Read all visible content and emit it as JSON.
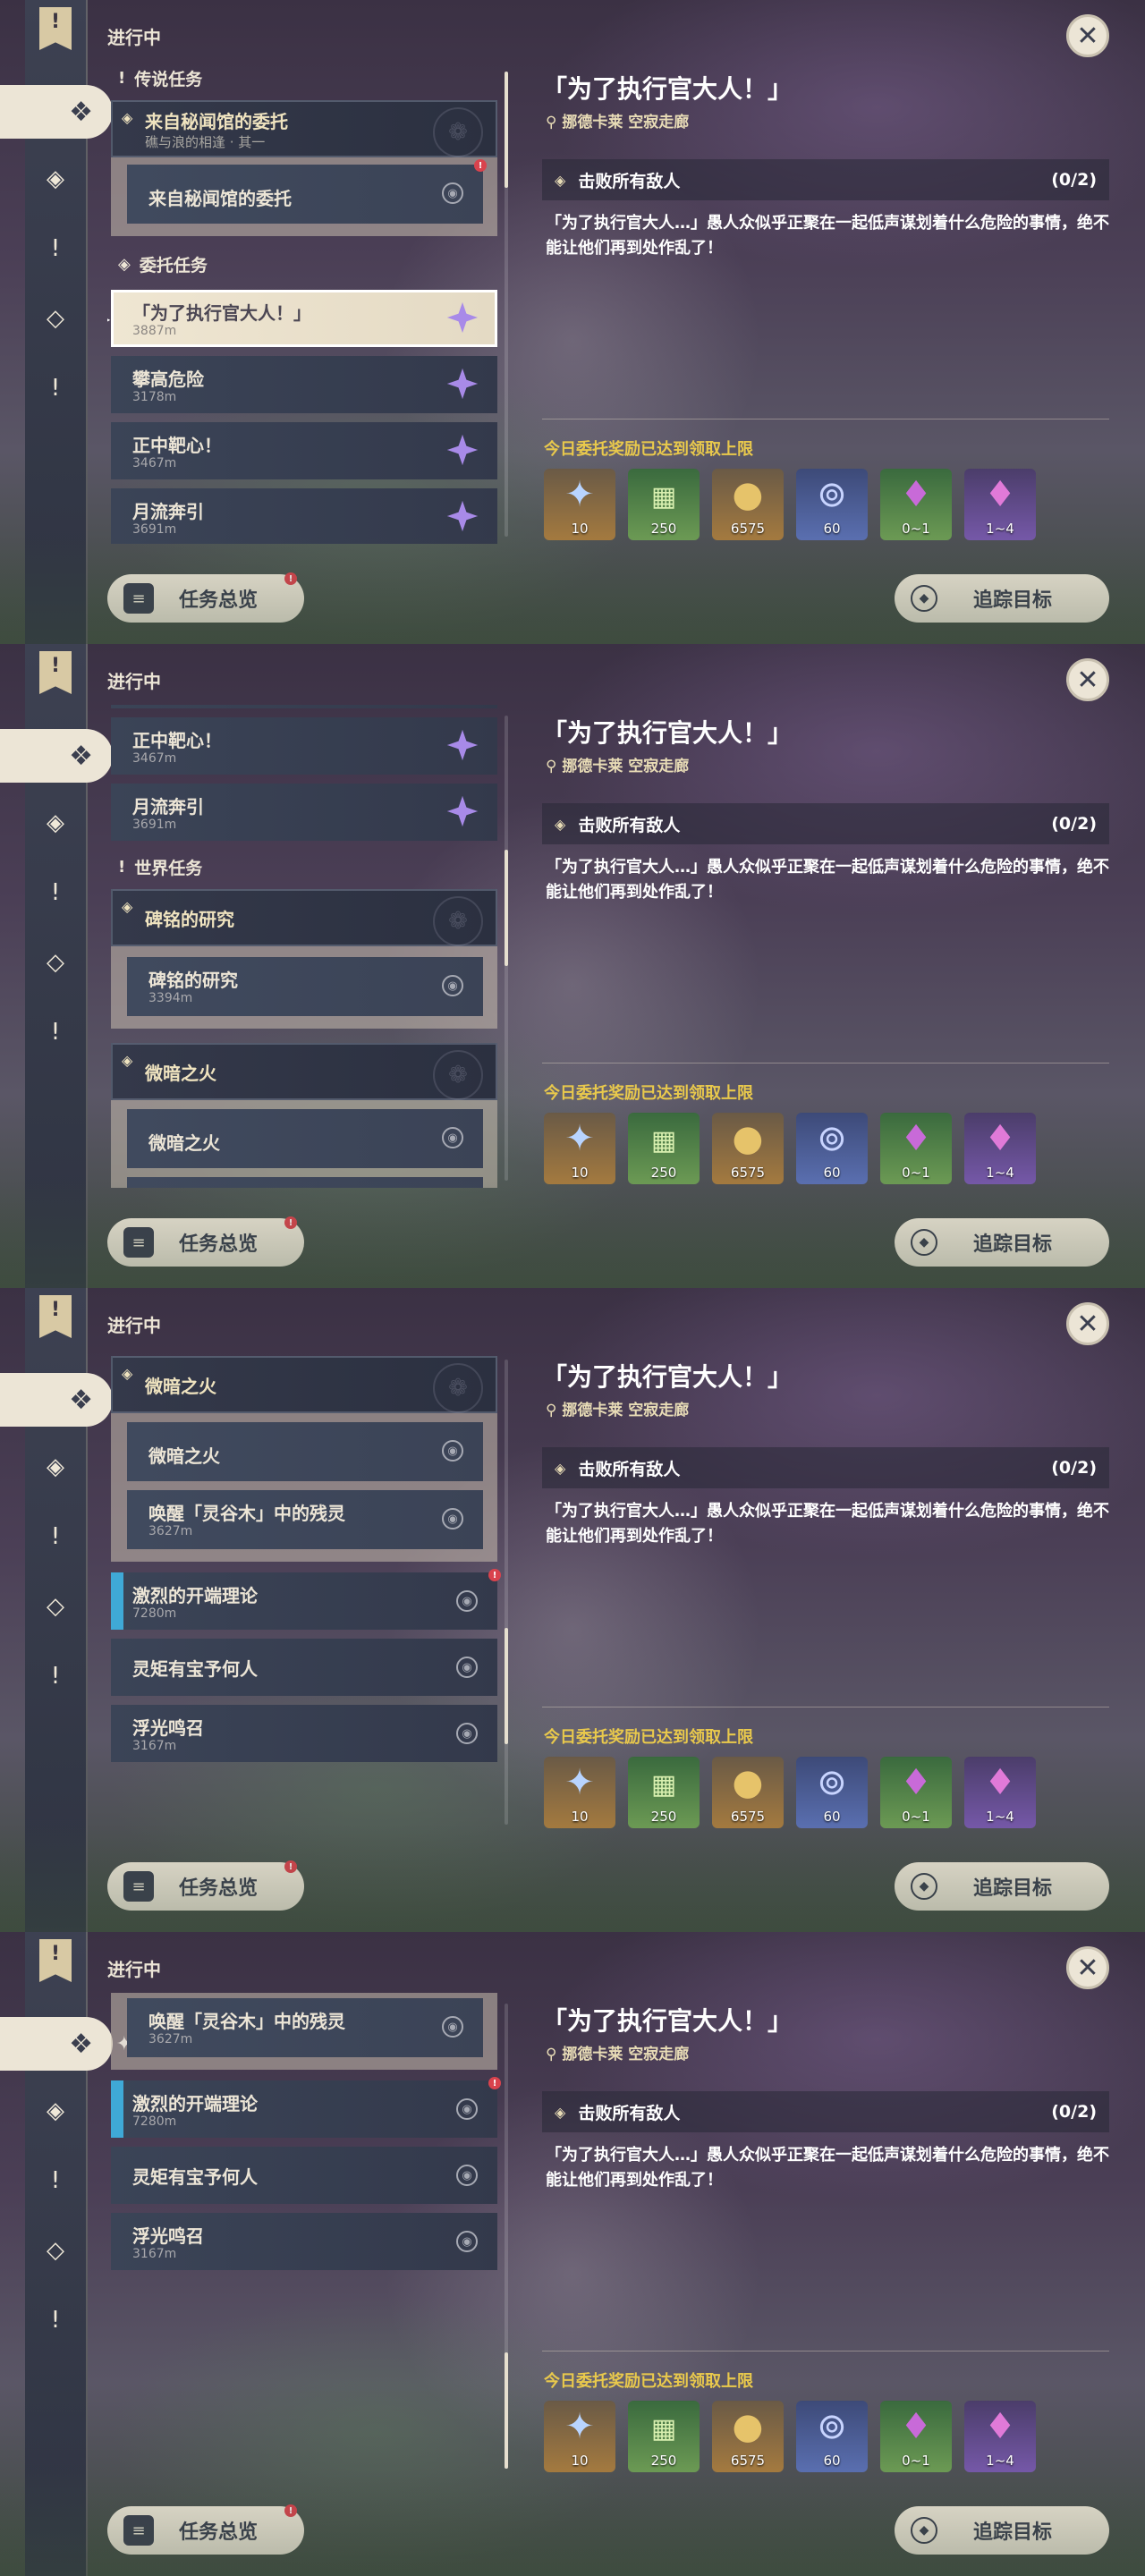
{
  "header": {
    "in_progress": "进行中"
  },
  "sidebar": {
    "icons": [
      "bookmark-icon",
      "all-quests-icon",
      "archon-quests-icon",
      "story-quests-icon",
      "commission-quests-icon",
      "world-quests-icon"
    ]
  },
  "sections": {
    "legend": "传说任务",
    "commission": "委托任务",
    "world": "世界任务"
  },
  "legend_group": {
    "title": "来自秘闻馆的委托",
    "subtitle": "礁与浪的相逢 · 其一",
    "child": "来自秘闻馆的委托"
  },
  "commissions": [
    {
      "title": "「为了执行官大人！」",
      "distance": "3887m"
    },
    {
      "title": "攀高危险",
      "distance": "3178m"
    },
    {
      "title": "正中靶心！",
      "distance": "3467m"
    },
    {
      "title": "月流奔引",
      "distance": "3691m"
    }
  ],
  "world_groups": {
    "stele": {
      "title": "碑铭的研究",
      "child_title": "碑铭的研究",
      "child_distance": "3394m"
    },
    "faint": {
      "title": "微暗之火",
      "child1_title": "微暗之火",
      "child2_title": "唤醒「灵谷木」中的残灵",
      "child2_distance": "3627m"
    }
  },
  "world_quests": [
    {
      "title": "激烈的开端理论",
      "distance": "7280m"
    },
    {
      "title": "灵矩有宝予何人",
      "distance": ""
    },
    {
      "title": "浮光鸣召",
      "distance": "3167m"
    }
  ],
  "detail": {
    "title": "「为了执行官大人！」",
    "location": "挪德卡莱 空寂走廊",
    "objective": "击败所有敌人",
    "progress": "(0/2)",
    "description": "「为了执行官大人…」愚人众似乎正聚在一起低声谋划着什么危险的事情，绝不能让他们再到处作乱了！",
    "reward_note": "今日委托奖励已达到领取上限",
    "rewards": [
      {
        "icon": "primogem-icon",
        "qty": "10"
      },
      {
        "icon": "adventure-exp-icon",
        "qty": "250"
      },
      {
        "icon": "mora-icon",
        "qty": "6575"
      },
      {
        "icon": "companionship-exp-icon",
        "qty": "60"
      },
      {
        "icon": "purple-crystal-icon",
        "qty": "0~1"
      },
      {
        "icon": "purple-crystal-cluster-icon",
        "qty": "1~4"
      }
    ]
  },
  "buttons": {
    "overview": "任务总览",
    "track": "追踪目标"
  },
  "scroll_states": [
    0,
    0.3,
    0.7,
    1.0
  ]
}
